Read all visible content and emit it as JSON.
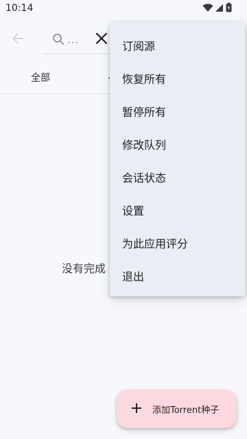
{
  "status_bar": {
    "time": "10:14",
    "icons": [
      "wifi-icon",
      "cell-signal-icon",
      "battery-icon"
    ]
  },
  "app_bar": {
    "back_icon": "back-arrow-icon",
    "search": {
      "placeholder": "..."
    },
    "clear_icon": "close-icon"
  },
  "tabs": [
    {
      "label": "全部"
    },
    {
      "label": "..."
    }
  ],
  "empty_state": {
    "text": "没有完成"
  },
  "menu": {
    "items": [
      {
        "label": "订阅源"
      },
      {
        "label": "恢复所有"
      },
      {
        "label": "暂停所有"
      },
      {
        "label": "修改队列"
      },
      {
        "label": "会话状态"
      },
      {
        "label": "设置"
      },
      {
        "label": "为此应用评分"
      },
      {
        "label": "退出"
      }
    ]
  },
  "fab": {
    "label": "添加Torrent种子",
    "icon": "plus-icon"
  },
  "colors": {
    "background": "#f7f8fb",
    "menu_background": "#e9eef5",
    "fab_background": "#fbd9df"
  }
}
